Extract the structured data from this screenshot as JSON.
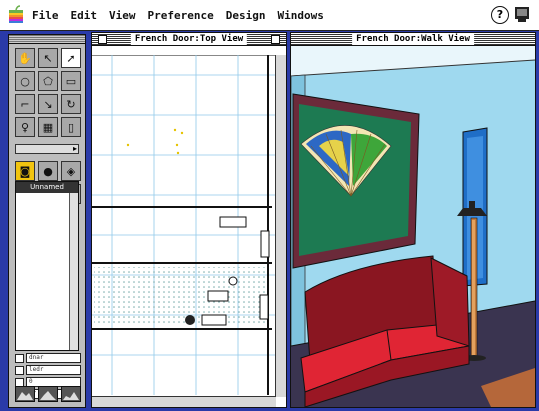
{
  "menubar": {
    "items": [
      "File",
      "Edit",
      "View",
      "Preference",
      "Design",
      "Windows"
    ],
    "help_label": "?"
  },
  "palette": {
    "list_header": "Unnamed",
    "fields": [
      "dnar",
      "ledr",
      "0",
      "or"
    ]
  },
  "top_view": {
    "title": "French Door:Top View"
  },
  "walk_view": {
    "title": "French Door:Walk View"
  },
  "colors": {
    "desktop": "#2a3aa8",
    "wall": "#9fd9ef",
    "floor": "#3a3450",
    "sofa": "#b61e2c",
    "frame": "#6b2a3a",
    "painting_bg": "#1d7a52"
  }
}
